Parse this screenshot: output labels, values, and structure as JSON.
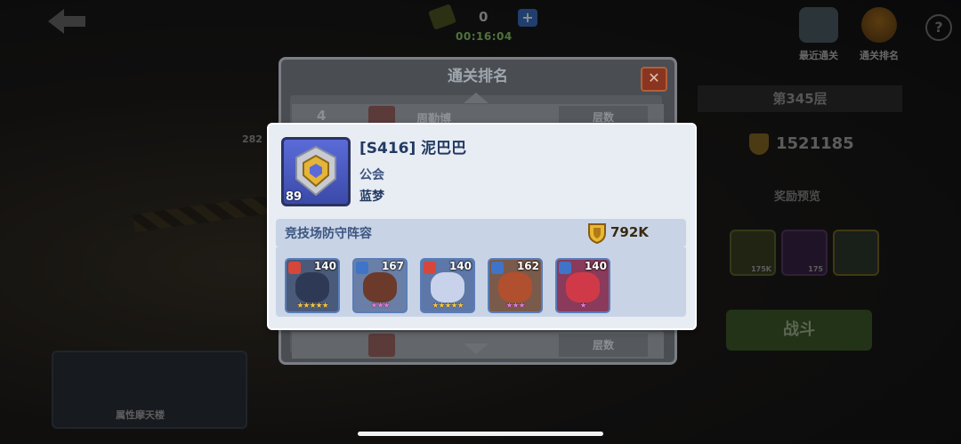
{
  "hud": {
    "resource_count": "0",
    "plus": "+",
    "timer": "00:16:04"
  },
  "top_buttons": {
    "recent_label": "最近通关",
    "rank_label": "通关排名",
    "help": "?"
  },
  "right_panel": {
    "floor": "第345层",
    "score": "1521185",
    "reward_preview": "奖励预览",
    "items": [
      {
        "qty": "175K"
      },
      {
        "qty": "175"
      },
      {
        "qty": ""
      }
    ],
    "fight_label": "战斗"
  },
  "bottom_left": {
    "label": "属性摩天楼",
    "side_number": "282"
  },
  "rank_dialog": {
    "title": "通关排名",
    "close": "✕",
    "rows": [
      {
        "rank": "4",
        "name": "周勤博",
        "col": "层数"
      },
      {
        "rank": "",
        "name": "",
        "col": "层数"
      }
    ]
  },
  "player_popup": {
    "level": "89",
    "name": "[S416] 泥巴巴",
    "guild_label": "公会",
    "guild_name": "蓝梦",
    "lineup_title": "竞技场防守阵容",
    "power": "792K",
    "heroes": [
      {
        "level": "140",
        "stars": "★★★★★",
        "star_color": "#f5c542",
        "class_color": "#d7463a"
      },
      {
        "level": "167",
        "stars": "★★★",
        "star_color": "#e07ad6",
        "class_color": "#3f74c9"
      },
      {
        "level": "140",
        "stars": "★★★★★",
        "star_color": "#f5c542",
        "class_color": "#d7463a"
      },
      {
        "level": "162",
        "stars": "★★★",
        "star_color": "#e07ad6",
        "class_color": "#3f74c9"
      },
      {
        "level": "140",
        "stars": "★",
        "star_color": "#e07ad6",
        "class_color": "#3f74c9"
      }
    ]
  }
}
